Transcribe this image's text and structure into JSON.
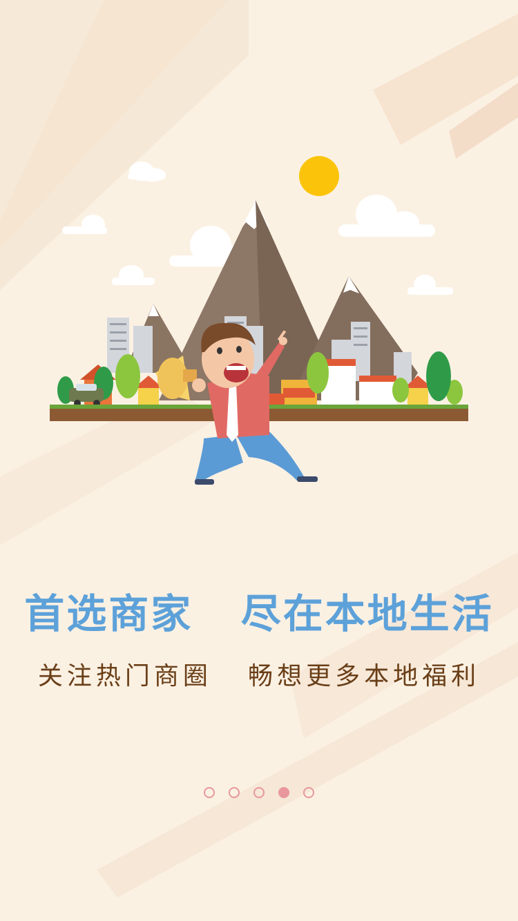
{
  "onboarding": {
    "headline": "首选商家   尽在本地生活",
    "subline": "关注热门商圈   畅想更多本地福利",
    "pager": {
      "page_count": 5,
      "active_page": 4
    }
  },
  "colors": {
    "background": "#fbf1e3",
    "headline": "#5da1d9",
    "subline": "#6a3f18",
    "dot": "#e8979b",
    "sun": "#fbc40a",
    "mountain": "#8a7462",
    "ground": "#8b5a33"
  },
  "icons": {
    "illustration": "city-mountains-man-with-megaphone-illustration"
  }
}
